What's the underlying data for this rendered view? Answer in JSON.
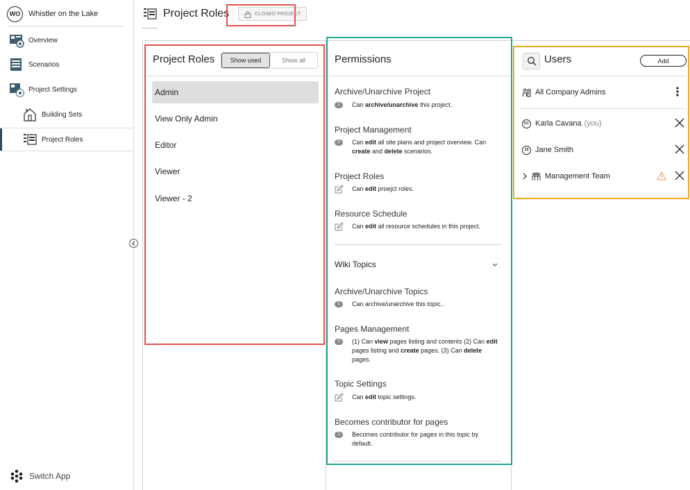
{
  "sidebar": {
    "project_initials": "WO",
    "project_name": "Whistler on the Lake",
    "items": [
      {
        "label": "Overview",
        "icon": "overview-icon"
      },
      {
        "label": "Scenarios",
        "icon": "scenarios-icon"
      },
      {
        "label": "Project Settings",
        "icon": "project-settings-icon"
      },
      {
        "label": "Building Sets",
        "icon": "building-sets-icon"
      },
      {
        "label": "Project Roles",
        "icon": "project-roles-icon",
        "active": true
      }
    ],
    "switch_app_label": "Switch App"
  },
  "header": {
    "title": "Project Roles",
    "status_badge": "CLOSED PROJECT"
  },
  "roles_panel": {
    "title": "Project Roles",
    "toggle": {
      "show_used": "Show used",
      "show_all": "Show all",
      "selected": "Show used"
    },
    "roles": [
      "Admin",
      "View Only Admin",
      "Editor",
      "Viewer",
      "Viewer - 2"
    ],
    "selected_role": "Admin"
  },
  "permissions_panel": {
    "title": "Permissions",
    "items": [
      {
        "title": "Archive/Unarchive Project",
        "marker": "1",
        "desc_pre": "Can ",
        "desc_bold": "archive/unarchive",
        "desc_post": " this project."
      },
      {
        "title": "Project Management",
        "marker": "5",
        "desc_html_parts": [
          "Can ",
          "edit",
          " all site plans and project overview. Can ",
          "create",
          " and ",
          "delete",
          " scenarios."
        ]
      },
      {
        "title": "Project Roles",
        "marker": "edit",
        "desc_pre": "Can ",
        "desc_bold": "edit",
        "desc_post": " proejct roles."
      },
      {
        "title": "Resource Schedule",
        "marker": "edit",
        "desc_pre": "Can ",
        "desc_bold": "edit",
        "desc_post": " all resource schedules in this project."
      }
    ],
    "wiki_section": "Wiki Topics",
    "wiki_items": [
      {
        "title": "Archive/Unarchive Topics",
        "marker": "1",
        "desc": "Can archive/unarchive this topic.."
      },
      {
        "title": "Pages Management",
        "marker": "3",
        "desc_parts": [
          "(1) Can ",
          "view",
          " pages listing and contents (2) Can ",
          "edit",
          " pages listing and ",
          "create",
          " pages. (3) Can ",
          "delete",
          " pages."
        ]
      },
      {
        "title": "Topic Settings",
        "marker": "edit",
        "desc_pre": "Can ",
        "desc_bold": "edit",
        "desc_post": " topic settings."
      },
      {
        "title": "Becomes contributor for pages",
        "marker": "1",
        "desc": "Becomes contributor for pages in this topic by default."
      }
    ]
  },
  "users_panel": {
    "title": "Users",
    "add_label": "Add",
    "group_all": "All Company Admins",
    "users": [
      {
        "initials": "KC",
        "name": "Karla Cavana",
        "suffix": "(you)"
      },
      {
        "initials": "JS",
        "name": "Jane Smith"
      },
      {
        "name": "Management Team",
        "type": "team",
        "warning": true
      }
    ]
  },
  "colors": {
    "highlight_red": "#e05252",
    "highlight_green": "#22a58f",
    "highlight_orange": "#f0a81e",
    "warning": "#f0a060"
  }
}
